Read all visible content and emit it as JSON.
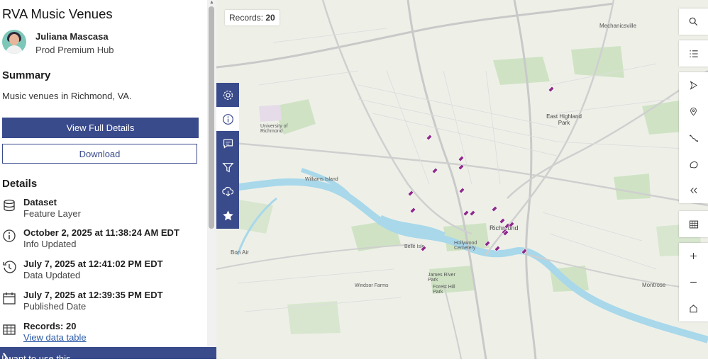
{
  "panel": {
    "title": "RVA Music Venues",
    "owner_name": "Juliana Mascasa",
    "owner_org": "Prod Premium Hub",
    "summary_heading": "Summary",
    "summary_text": "Music venues in Richmond, VA.",
    "view_details_label": "View Full Details",
    "download_label": "Download",
    "details_heading": "Details",
    "details": [
      {
        "icon": "database-icon",
        "title": "Dataset",
        "sub": "Feature Layer"
      },
      {
        "icon": "info-icon",
        "title": "October 2, 2025 at 11:38:24 AM EDT",
        "sub": "Info Updated"
      },
      {
        "icon": "history-icon",
        "title": "July 7, 2025 at 12:41:02 PM EDT",
        "sub": "Data Updated"
      },
      {
        "icon": "calendar-icon",
        "title": "July 7, 2025 at 12:39:35 PM EDT",
        "sub": "Published Date"
      },
      {
        "icon": "table-icon",
        "title": "Records: 20",
        "sub": "View data table"
      }
    ],
    "footer_label": "I want to use this"
  },
  "map": {
    "records_label": "Records:",
    "records_count": "20",
    "place_labels": [
      "Richmond",
      "East Highland Park",
      "Bon Air",
      "Montrose",
      "Mechanicsville",
      "University of Richmond",
      "Williams Island",
      "Belle Isle",
      "Hollywood Cemetery",
      "Forest Hill Park",
      "James River Park",
      "Windsor Farms"
    ],
    "left_tools": [
      "gear-icon",
      "info-icon",
      "comment-icon",
      "filter-icon",
      "cloud-download-icon",
      "star-icon"
    ],
    "right_tools_top": [
      "search-icon",
      "legend-icon",
      "directions-icon",
      "locate-icon",
      "measure-icon",
      "basemap-icon",
      "collapse-icon"
    ],
    "right_tools_table": [
      "table-icon"
    ],
    "right_tools_zoom": [
      "zoom-in-icon",
      "zoom-out-icon",
      "home-icon"
    ],
    "accent": "#3a4b8c",
    "marker_color": "#8e2a8a",
    "water_color": "#a8d8ea"
  }
}
